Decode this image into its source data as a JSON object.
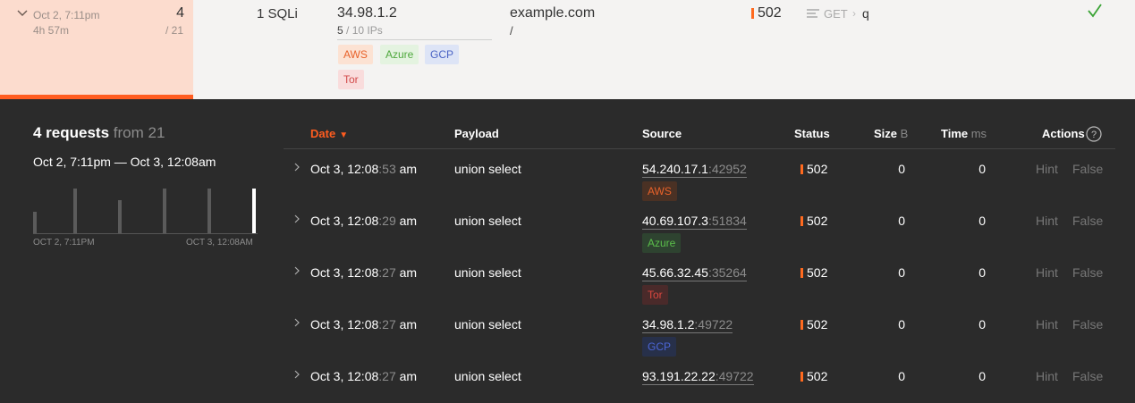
{
  "summary": {
    "time": "Oct 2, 7:11pm",
    "duration": "4h 57m",
    "count": "4",
    "total": "/ 21",
    "attack": "1 SQLi",
    "ip": "34.98.1.2",
    "ip_count": "5",
    "ip_total": " / 10 IPs",
    "tags": [
      "AWS",
      "Azure",
      "GCP",
      "Tor"
    ],
    "domain": "example.com",
    "path": "/",
    "status": "502",
    "method": "GET",
    "separator": "›",
    "param": "q",
    "colors": {
      "accent": "#ff5c1f",
      "highlight_bg": "#fcdcce",
      "check": "#3aa335"
    }
  },
  "panel": {
    "title_count": "4 requests",
    "title_from": " from 21",
    "range": "Oct 2, 7:11pm — Oct 3, 12:08am",
    "histogram": {
      "start_label": "OCT 2, 7:11PM",
      "end_label": "OCT 3, 12:08AM",
      "bars": [
        0.48,
        1.0,
        0.74,
        1.0,
        1.0,
        1.0
      ],
      "highlight_index": 5
    }
  },
  "table": {
    "headers": {
      "date": "Date",
      "sort_indicator": "▼",
      "payload": "Payload",
      "source": "Source",
      "status": "Status",
      "size": "Size",
      "size_unit": " B",
      "time": "Time",
      "time_unit": " ms",
      "actions": "Actions"
    },
    "rows": [
      {
        "date": "Oct 3, 12:08",
        "sec": ":53",
        "ampm": " am",
        "payload": "union select",
        "ip": "54.240.17.1",
        "port": ":42952",
        "tag": "AWS",
        "tag_type": "aws",
        "status": "502",
        "size": "0",
        "time": "0",
        "hint": "Hint",
        "false": "False"
      },
      {
        "date": "Oct 3, 12:08",
        "sec": ":29",
        "ampm": " am",
        "payload": "union select",
        "ip": "40.69.107.3",
        "port": ":51834",
        "tag": "Azure",
        "tag_type": "azure",
        "status": "502",
        "size": "0",
        "time": "0",
        "hint": "Hint",
        "false": "False"
      },
      {
        "date": "Oct 3, 12:08",
        "sec": ":27",
        "ampm": " am",
        "payload": "union select",
        "ip": "45.66.32.45",
        "port": ":35264",
        "tag": "Tor",
        "tag_type": "tor",
        "status": "502",
        "size": "0",
        "time": "0",
        "hint": "Hint",
        "false": "False"
      },
      {
        "date": "Oct 3, 12:08",
        "sec": ":27",
        "ampm": " am",
        "payload": "union select",
        "ip": "34.98.1.2",
        "port": ":49722",
        "tag": "GCP",
        "tag_type": "gcp",
        "status": "502",
        "size": "0",
        "time": "0",
        "hint": "Hint",
        "false": "False"
      },
      {
        "date": "Oct 3, 12:08",
        "sec": ":27",
        "ampm": " am",
        "payload": "union select",
        "ip": "93.191.22.22",
        "port": ":49722",
        "tag": "",
        "tag_type": "",
        "status": "502",
        "size": "0",
        "time": "0",
        "hint": "Hint",
        "false": "False"
      }
    ]
  }
}
